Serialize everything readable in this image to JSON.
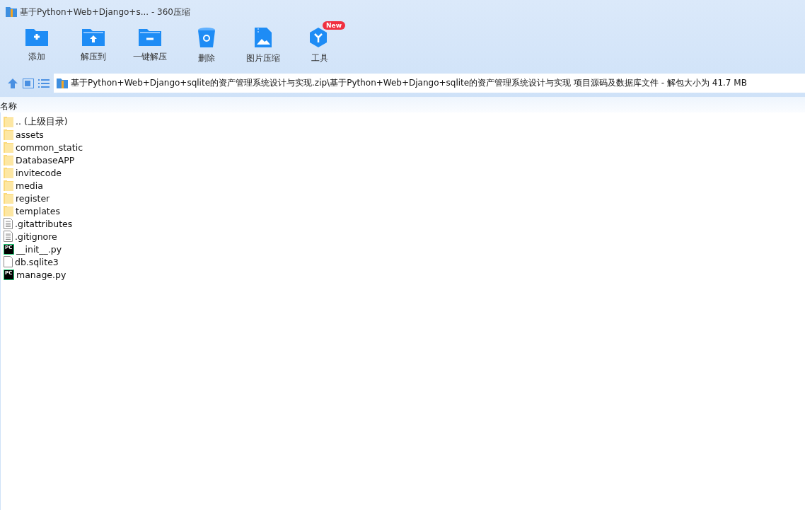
{
  "window": {
    "title": "基于Python+Web+Django+s... - 360压缩"
  },
  "toolbar": [
    {
      "kind": "add",
      "label": "添加"
    },
    {
      "kind": "extract",
      "label": "解压到"
    },
    {
      "kind": "oneclick",
      "label": "一键解压"
    },
    {
      "kind": "delete",
      "label": "删除"
    },
    {
      "kind": "image",
      "label": "图片压缩"
    },
    {
      "kind": "tools",
      "label": "工具",
      "badge": "New"
    }
  ],
  "address": {
    "path": "基于Python+Web+Django+sqlite的资产管理系统设计与实现.zip\\基于Python+Web+Django+sqlite的资产管理系统设计与实现 项目源码及数据库文件 - 解包大小为 41.7 MB"
  },
  "file_list": {
    "columns": [
      "名称"
    ],
    "rows": [
      {
        "kind": "folder",
        "name": ".. (上级目录)"
      },
      {
        "kind": "folder",
        "name": "assets"
      },
      {
        "kind": "folder",
        "name": "common_static"
      },
      {
        "kind": "folder",
        "name": "DatabaseAPP"
      },
      {
        "kind": "folder",
        "name": "invitecode"
      },
      {
        "kind": "folder",
        "name": "media"
      },
      {
        "kind": "folder",
        "name": "register"
      },
      {
        "kind": "folder",
        "name": "templates"
      },
      {
        "kind": "text",
        "name": ".gitattributes"
      },
      {
        "kind": "text",
        "name": ".gitignore"
      },
      {
        "kind": "pycharm",
        "name": "__init__.py",
        "icon_label": "PC"
      },
      {
        "kind": "blank",
        "name": "db.sqlite3"
      },
      {
        "kind": "pycharm",
        "name": "manage.py",
        "icon_label": "PC"
      }
    ]
  }
}
